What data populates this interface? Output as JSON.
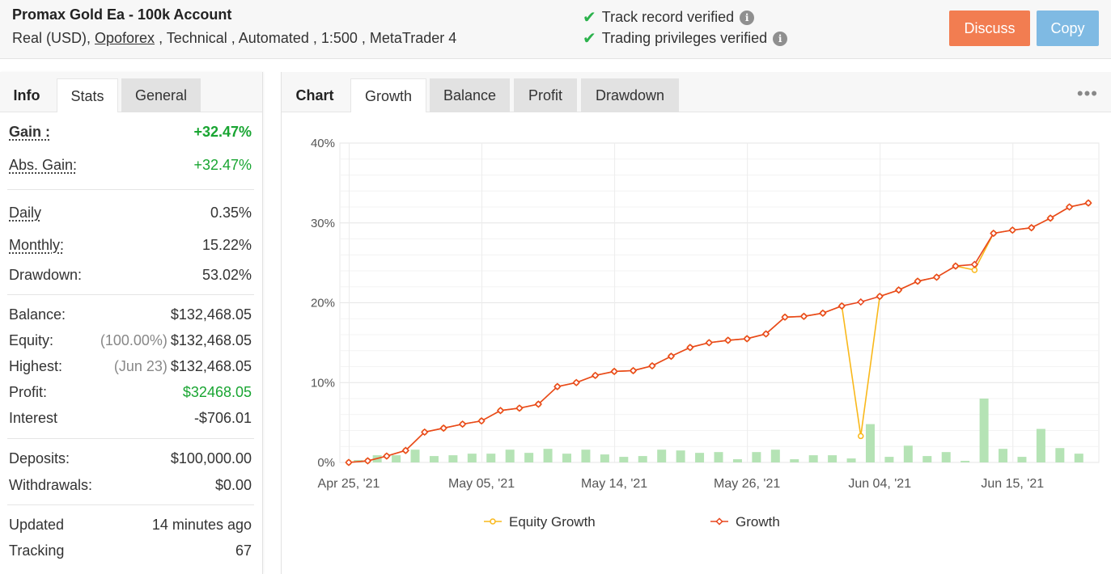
{
  "header": {
    "title": "Promax Gold Ea - 100k Account",
    "sub_prefix": "Real (USD), ",
    "broker": "Opoforex",
    "sub_suffix": " , Technical , Automated , 1:500 , MetaTrader 4",
    "verified": [
      {
        "label": "Track record verified",
        "icon": "info-icon"
      },
      {
        "label": "Trading privileges verified",
        "icon": "info-icon"
      }
    ],
    "discuss_label": "Discuss",
    "copy_label": "Copy",
    "colors": {
      "discuss": "#f27d51",
      "copy": "#7fbae3",
      "check": "#2bb24c"
    }
  },
  "left_tabs": {
    "info": "Info",
    "stats": "Stats",
    "general": "General"
  },
  "stats": {
    "gain": {
      "label": "Gain :",
      "value": "+32.47%"
    },
    "abs_gain": {
      "label": "Abs. Gain:",
      "value": "+32.47%"
    },
    "daily": {
      "label": "Daily",
      "value": "0.35%"
    },
    "monthly": {
      "label": "Monthly:",
      "value": "15.22%"
    },
    "drawdown": {
      "label": "Drawdown:",
      "value": "53.02%"
    },
    "balance": {
      "label": "Balance:",
      "value": "$132,468.05"
    },
    "equity": {
      "label": "Equity:",
      "note": "(100.00%)",
      "value": "$132,468.05"
    },
    "highest": {
      "label": "Highest:",
      "note": "(Jun 23)",
      "value": "$132,468.05"
    },
    "profit": {
      "label": "Profit:",
      "value": "$32468.05"
    },
    "interest": {
      "label": "Interest",
      "value": "-$706.01"
    },
    "deposits": {
      "label": "Deposits:",
      "value": "$100,000.00"
    },
    "withdrawals": {
      "label": "Withdrawals:",
      "value": "$0.00"
    },
    "updated": {
      "label": "Updated",
      "value": "14 minutes ago"
    },
    "tracking": {
      "label": "Tracking",
      "value": "67"
    }
  },
  "right_tabs": {
    "chart": "Chart",
    "growth": "Growth",
    "balance": "Balance",
    "profit": "Profit",
    "drawdown": "Drawdown",
    "more_icon": "more-dots-icon"
  },
  "chart_data": {
    "type": "line",
    "yticks": [
      "0%",
      "10%",
      "20%",
      "30%",
      "40%"
    ],
    "ylim": [
      0,
      40
    ],
    "xticks": [
      "Apr 25, '21",
      "May 05, '21",
      "May 14, '21",
      "May 26, '21",
      "Jun 04, '21",
      "Jun 15, '21"
    ],
    "grid": true,
    "legend_position": "bottom",
    "series": [
      {
        "name": "Equity Growth",
        "color": "#f9b81b",
        "values": [
          0.0,
          0.2,
          0.8,
          1.5,
          3.8,
          4.3,
          4.8,
          5.2,
          6.5,
          6.8,
          7.3,
          9.5,
          10.0,
          10.9,
          11.4,
          11.5,
          12.1,
          13.3,
          14.4,
          15.0,
          15.3,
          15.5,
          16.1,
          18.2,
          18.3,
          18.7,
          19.6,
          3.3,
          20.8,
          21.6,
          22.7,
          23.2,
          24.6,
          24.1,
          28.7,
          29.1,
          29.4,
          30.6,
          32.0,
          32.5
        ]
      },
      {
        "name": "Growth",
        "color": "#e8461e",
        "values": [
          0.0,
          0.2,
          0.8,
          1.5,
          3.8,
          4.3,
          4.8,
          5.2,
          6.5,
          6.8,
          7.3,
          9.5,
          10.0,
          10.9,
          11.4,
          11.5,
          12.1,
          13.3,
          14.4,
          15.0,
          15.3,
          15.5,
          16.1,
          18.2,
          18.3,
          18.7,
          19.6,
          20.1,
          20.8,
          21.6,
          22.7,
          23.2,
          24.6,
          24.8,
          28.7,
          29.1,
          29.4,
          30.6,
          32.0,
          32.5
        ]
      }
    ],
    "bars": {
      "color": "#b5e3b5",
      "values": [
        0.3,
        0.9,
        0.9,
        1.6,
        0.8,
        0.9,
        1.1,
        1.1,
        1.6,
        1.2,
        1.7,
        1.1,
        1.6,
        1.0,
        0.7,
        0.8,
        1.6,
        1.5,
        1.2,
        1.3,
        0.4,
        1.3,
        1.6,
        0.4,
        0.9,
        0.9,
        0.5,
        4.8,
        0.7,
        2.1,
        0.8,
        1.3,
        0.2,
        8.0,
        1.7,
        0.7,
        4.2,
        1.8,
        1.1
      ]
    }
  }
}
